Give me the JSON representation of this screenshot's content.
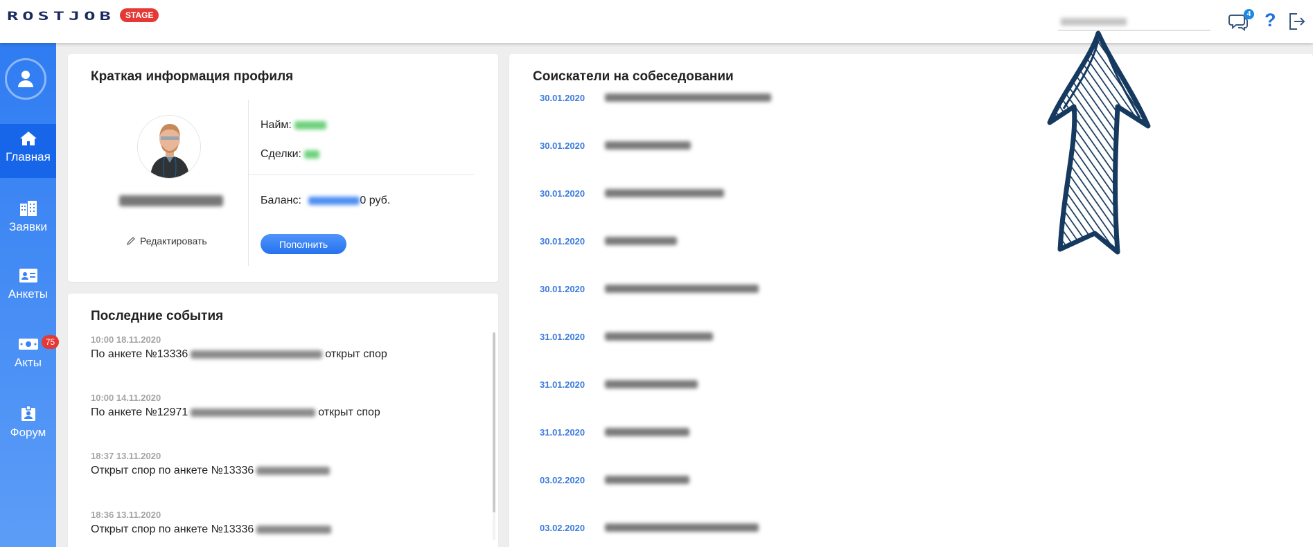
{
  "header": {
    "logo_text": "ROSTJOB",
    "stage_badge": "STAGE",
    "messages_count": "4",
    "help_label": "?"
  },
  "sidebar": {
    "items": [
      {
        "label": "Главная",
        "icon": "home-icon",
        "active": true
      },
      {
        "label": "Заявки",
        "icon": "buildings-icon"
      },
      {
        "label": "Анкеты",
        "icon": "id-card-icon"
      },
      {
        "label": "Акты",
        "icon": "money-icon",
        "badge": "75"
      },
      {
        "label": "Форум",
        "icon": "badge-icon"
      }
    ]
  },
  "profile": {
    "title": "Краткая информация профиля",
    "edit_label": "Редактировать",
    "hires_label": "Найм:",
    "deals_label": "Сделки:",
    "balance_label": "Баланс:",
    "balance_suffix": "0 руб.",
    "topup_label": "Пополнить"
  },
  "events": {
    "title": "Последние события",
    "items": [
      {
        "time": "10:00 18.11.2020",
        "prefix": "По анкете №13336",
        "suffix": "открыт спор"
      },
      {
        "time": "10:00 14.11.2020",
        "prefix": "По анкете №12971",
        "suffix": "открыт спор"
      },
      {
        "time": "18:37 13.11.2020",
        "prefix": "Открыт спор по анкете №13336",
        "suffix": ""
      },
      {
        "time": "18:36 13.11.2020",
        "prefix": "Открыт спор по анкете №13336",
        "suffix": ""
      }
    ]
  },
  "candidates": {
    "title": "Соискатели на собеседовании",
    "dates": [
      "30.01.2020",
      "30.01.2020",
      "30.01.2020",
      "30.01.2020",
      "30.01.2020",
      "31.01.2020",
      "31.01.2020",
      "31.01.2020",
      "03.02.2020",
      "03.02.2020"
    ]
  },
  "colors": {
    "accent": "#2f7cf2",
    "badge_red": "#e53935",
    "date_blue": "#3b7bdc"
  }
}
